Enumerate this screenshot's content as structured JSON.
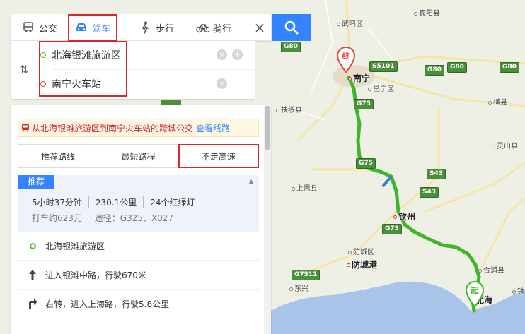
{
  "modes": [
    {
      "label": "公交",
      "icon": "bus-icon"
    },
    {
      "label": "驾车",
      "icon": "car-icon"
    },
    {
      "label": "步行",
      "icon": "walk-icon"
    },
    {
      "label": "骑行",
      "icon": "bike-icon"
    }
  ],
  "active_mode": "驾车",
  "route": {
    "origin": "北海银滩旅游区",
    "destination": "南宁火车站"
  },
  "notice": {
    "text": "从北海银滩旅游区到南宁火车站的跨城公交",
    "link": "查看线路"
  },
  "route_tabs": [
    "推荐路线",
    "最短路程",
    "不走高速"
  ],
  "selected_route_tab": "不走高速",
  "plan": {
    "badge": "推荐",
    "duration": "5小时37分钟",
    "distance": "230.1公里",
    "lights": "24个红绿灯",
    "taxi": "打车约623元",
    "via": "途径：G325、X027"
  },
  "steps": [
    {
      "text": "北海银滩旅游区",
      "icon": "origin-dot-icon"
    },
    {
      "text": "进入银滩中路，行驶670米",
      "icon": "arrow-up-icon"
    },
    {
      "text": "右转，进入上海路，行驶5.8公里",
      "icon": "turn-right-icon"
    }
  ],
  "map": {
    "colors": {
      "route": "#3fb62a",
      "route_alt": "#3a7fd5",
      "sea": "#a9c4e8",
      "land": "#eef0e6"
    },
    "markers": {
      "start": "起",
      "end": "终"
    },
    "places": [
      {
        "name": "宾阳县",
        "kind": "town"
      },
      {
        "name": "武鸣区",
        "kind": "town"
      },
      {
        "name": "南宁",
        "kind": "city"
      },
      {
        "name": "邕宁区",
        "kind": "town"
      },
      {
        "name": "横县",
        "kind": "town"
      },
      {
        "name": "扶绥县",
        "kind": "town"
      },
      {
        "name": "灵山县",
        "kind": "town"
      },
      {
        "name": "上思县",
        "kind": "town"
      },
      {
        "name": "钦州",
        "kind": "city"
      },
      {
        "name": "防城区",
        "kind": "town"
      },
      {
        "name": "防城港",
        "kind": "city"
      },
      {
        "name": "合浦县",
        "kind": "town"
      },
      {
        "name": "东兴",
        "kind": "town"
      },
      {
        "name": "北海",
        "kind": "city"
      },
      {
        "name": "铁",
        "kind": "town"
      }
    ],
    "highways": [
      "G80",
      "S5101",
      "G80",
      "G80",
      "G80",
      "G75",
      "G75",
      "S43",
      "S43",
      "G75",
      "G7511"
    ]
  }
}
